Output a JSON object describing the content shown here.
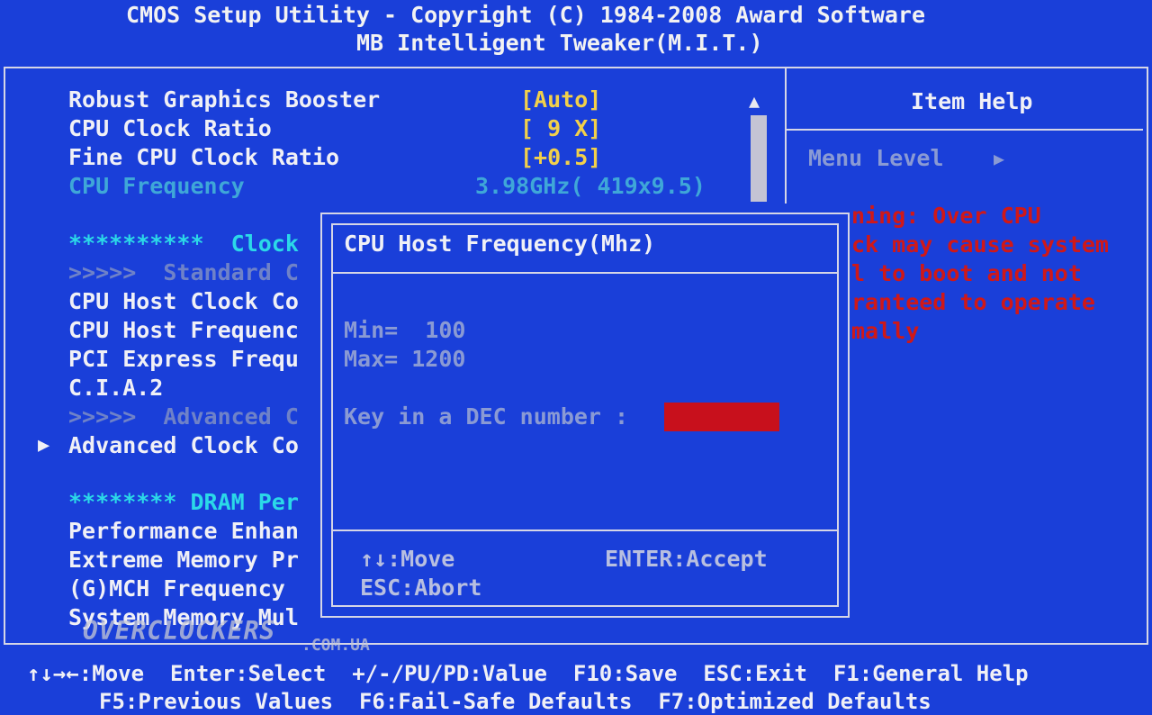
{
  "header": {
    "line1": "CMOS Setup Utility - Copyright (C) 1984-2008 Award Software",
    "line2": "MB Intelligent Tweaker(M.I.T.)"
  },
  "menu": {
    "rows": [
      {
        "label": "Robust Graphics Booster",
        "value": "[Auto]"
      },
      {
        "label": "CPU Clock Ratio",
        "value": "[ 9 X]"
      },
      {
        "label": "Fine CPU Clock Ratio",
        "value": "[+0.5]"
      },
      {
        "label": "CPU Frequency",
        "value": "3.98GHz( 419x9.5)"
      }
    ],
    "clock_section": "**********  Clock",
    "standard_sub": ">>>>>  Standard C",
    "clock_items": [
      "CPU Host Clock Co",
      "CPU Host Frequenc",
      "PCI Express Frequ",
      "C.I.A.2"
    ],
    "advanced_sub": ">>>>>  Advanced C",
    "advanced_item": "Advanced Clock Co",
    "advanced_arrow": "▶",
    "dram_section": "******** DRAM Per",
    "dram_items": [
      "Performance Enhan",
      "Extreme Memory Pr",
      "(G)MCH Frequency",
      "System Memory Mul"
    ]
  },
  "scroll": {
    "up_arrow": "▲"
  },
  "help": {
    "title": "Item Help",
    "menu_level": "Menu Level",
    "menu_level_arrow": "▶",
    "warning_lines": [
      "ning: Over CPU",
      "ck may cause system",
      "l to boot and not",
      "ranteed to operate",
      "mally"
    ]
  },
  "dialog": {
    "title": "CPU Host Frequency(Mhz)",
    "min": "Min=  100",
    "max": "Max= 1200",
    "prompt": "Key in a DEC number :",
    "entry_value": "",
    "hint_move": "↑↓:Move",
    "hint_accept": "ENTER:Accept",
    "hint_abort": "ESC:Abort"
  },
  "footer": {
    "line1": "↑↓→←:Move  Enter:Select  +/-/PU/PD:Value  F10:Save  ESC:Exit  F1:General Help",
    "line2": "F5:Previous Values  F6:Fail-Safe Defaults  F7:Optimized Defaults"
  },
  "watermark": {
    "text": "OVERCLOCKERS",
    "domain": ".COM.UA"
  },
  "colors": {
    "background": "#1a3fd9",
    "value_yellow": "#f2d04a",
    "info_cyan": "#2bd9e8",
    "warning_red": "#d01818",
    "entry_red": "#c8101c"
  }
}
